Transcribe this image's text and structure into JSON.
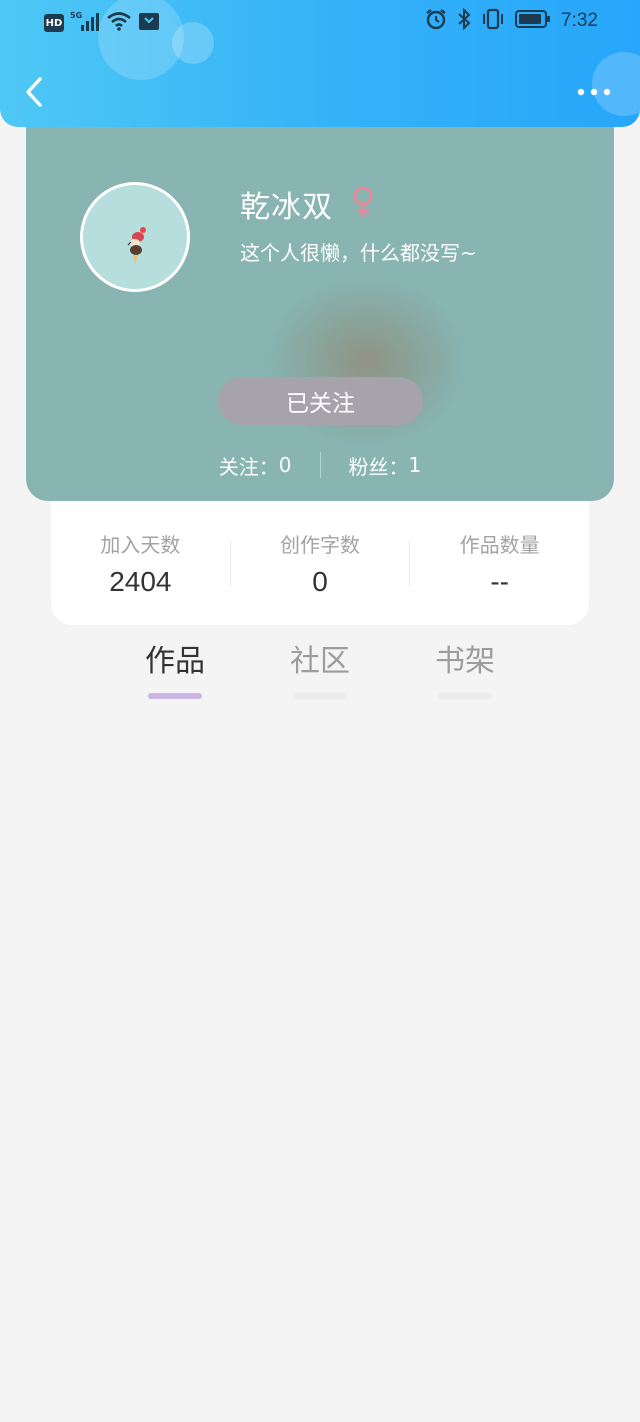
{
  "status_bar": {
    "network_badge": "HD",
    "signal_label": "5G",
    "time": "7:32",
    "icons": [
      "signal-icon",
      "wifi-icon",
      "notification-icon",
      "alarm-icon",
      "bluetooth-icon",
      "vibrate-icon",
      "battery-icon"
    ]
  },
  "header": {
    "back_icon": "chevron-left-icon",
    "more_icon": "more-dots-icon",
    "gradient_colors": [
      "#4fc8f5",
      "#27a6fb"
    ]
  },
  "profile": {
    "username": "乾冰双",
    "gender_icon": "female-symbol-icon",
    "gender_color": "#e48a99",
    "bio": "这个人很懒，什么都没写~",
    "follow_button": "已关注",
    "following_label": "关注：",
    "following_count": "0",
    "fans_label": "粉丝：",
    "fans_count": "1",
    "card_color": "#88b4b2"
  },
  "stats": [
    {
      "label": "加入天数",
      "value": "2404"
    },
    {
      "label": "创作字数",
      "value": "0"
    },
    {
      "label": "作品数量",
      "value": "--"
    }
  ],
  "tabs": [
    {
      "label": "作品",
      "active": true
    },
    {
      "label": "社区",
      "active": false
    },
    {
      "label": "书架",
      "active": false
    }
  ],
  "colors": {
    "accent_tab_indicator": "#cbb5e4",
    "page_background": "#f4f4f4"
  }
}
